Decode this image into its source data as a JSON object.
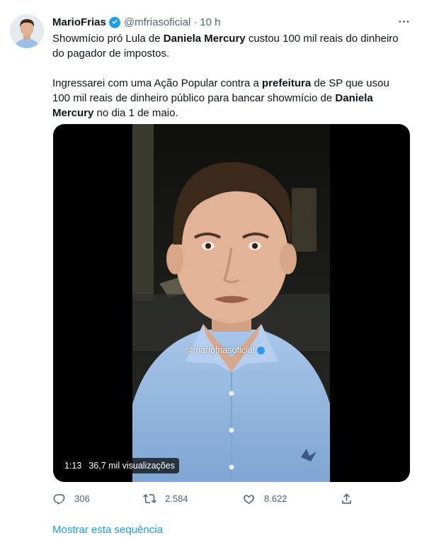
{
  "tweet": {
    "author_name": "MarioFrias",
    "handle": "@mfriasoficial",
    "separator": "·",
    "time": "10 h",
    "p1_a": "Showmício pró Lula de ",
    "p1_b": "Daniela Mercury",
    "p1_c": " custou 100 mil reais do dinheiro do pagador de impostos.",
    "p2_a": "Ingressarei com uma Ação Popular contra a ",
    "p2_b": "prefeitura",
    "p2_c": " de SP que usou 100 mil reais de dinheiro público para bancar showmício de ",
    "p2_d": "Daniela Mercury",
    "p2_e": " no dia 1 de maio."
  },
  "video": {
    "watermark": "@mariofriasoficial",
    "duration": "1:13",
    "views": "36,7 mil visualizações"
  },
  "actions": {
    "replies": "306",
    "retweets": "2.584",
    "likes": "8.622"
  },
  "show_thread": "Mostrar esta sequência",
  "colors": {
    "accent": "#1d9bf0",
    "secondary_text": "#536471",
    "primary_text": "#0f1419",
    "shirt": "#8fb5df"
  },
  "icons": [
    "more-icon",
    "verified-icon",
    "reply-icon",
    "retweet-icon",
    "like-icon",
    "share-icon"
  ]
}
